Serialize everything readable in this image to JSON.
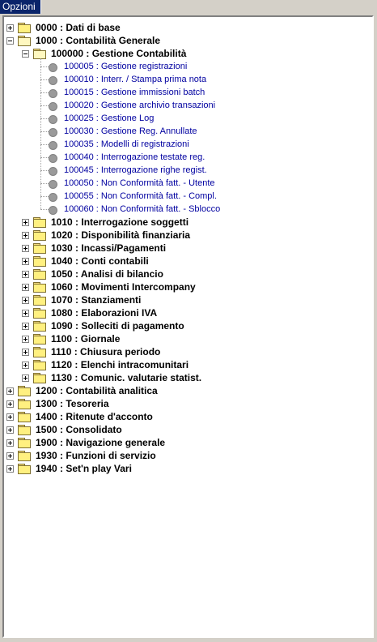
{
  "tab": {
    "label": "Opzioni"
  },
  "tree": {
    "root_items": [
      {
        "text": "0000 : Dati di base",
        "expanded": false
      },
      {
        "text": "1000 : Contabilità Generale",
        "expanded": true
      },
      {
        "text": "1200 : Contabilità analitica",
        "expanded": false
      },
      {
        "text": "1300 : Tesoreria",
        "expanded": false
      },
      {
        "text": "1400 : Ritenute d'acconto",
        "expanded": false
      },
      {
        "text": "1500 : Consolidato",
        "expanded": false
      },
      {
        "text": "1900 : Navigazione generale",
        "expanded": false
      },
      {
        "text": "1930 : Funzioni di servizio",
        "expanded": false
      },
      {
        "text": "1940 : Set'n play Vari",
        "expanded": false
      }
    ],
    "cg_children": [
      {
        "text": "100000 : Gestione Contabilità",
        "expanded": true
      },
      {
        "text": "1010 : Interrogazione soggetti",
        "expanded": false
      },
      {
        "text": "1020 : Disponibilità finanziaria",
        "expanded": false
      },
      {
        "text": "1030 : Incassi/Pagamenti",
        "expanded": false
      },
      {
        "text": "1040 : Conti contabili",
        "expanded": false
      },
      {
        "text": "1050 : Analisi di bilancio",
        "expanded": false
      },
      {
        "text": "1060 : Movimenti Intercompany",
        "expanded": false
      },
      {
        "text": "1070 : Stanziamenti",
        "expanded": false
      },
      {
        "text": "1080 : Elaborazioni IVA",
        "expanded": false
      },
      {
        "text": "1090 : Solleciti di pagamento",
        "expanded": false
      },
      {
        "text": "1100 : Giornale",
        "expanded": false
      },
      {
        "text": "1110 : Chiusura periodo",
        "expanded": false
      },
      {
        "text": "1120 : Elenchi intracomunitari",
        "expanded": false
      },
      {
        "text": "1130 : Comunic. valutarie statist.",
        "expanded": false
      }
    ],
    "gc_leaves": [
      "100005 : Gestione registrazioni",
      "100010 : Interr. / Stampa prima nota",
      "100015 : Gestione immissioni batch",
      "100020 : Gestione archivio transazioni",
      "100025 : Gestione Log",
      "100030 : Gestione Reg. Annullate",
      "100035 : Modelli di registrazioni",
      "100040 : Interrogazione testate reg.",
      "100045 : Interrogazione righe regist.",
      "100050 : Non Conformità fatt. - Utente",
      "100055 : Non Conformità fatt. - Compl.",
      "100060 : Non Conformità fatt. - Sblocco"
    ]
  }
}
